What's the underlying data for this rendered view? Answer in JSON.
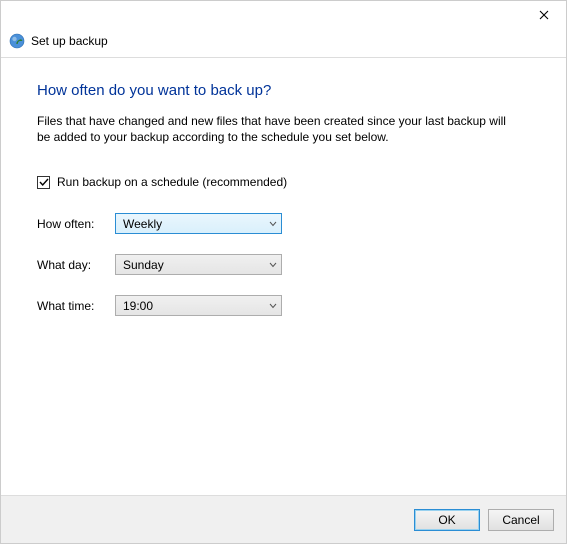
{
  "window": {
    "title": "Set up backup"
  },
  "main": {
    "heading": "How often do you want to back up?",
    "description": "Files that have changed and new files that have been created since your last backup will be added to your backup according to the schedule you set below."
  },
  "schedule": {
    "checkbox_label": "Run backup on a schedule (recommended)",
    "checked": true,
    "fields": {
      "how_often_label": "How often:",
      "how_often_value": "Weekly",
      "what_day_label": "What day:",
      "what_day_value": "Sunday",
      "what_time_label": "What time:",
      "what_time_value": "19:00"
    }
  },
  "footer": {
    "ok": "OK",
    "cancel": "Cancel"
  }
}
